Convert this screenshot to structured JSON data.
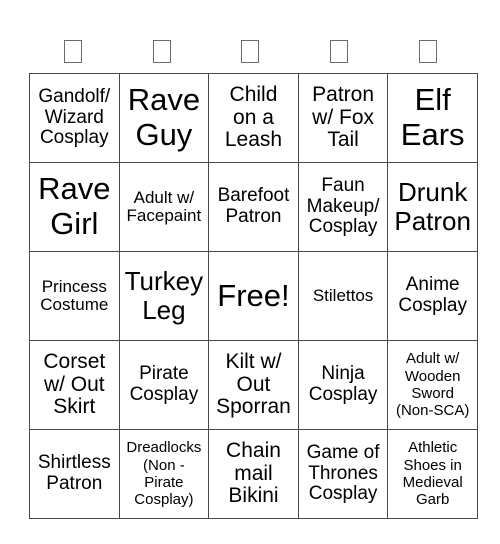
{
  "card": {
    "header": [
      "",
      "",
      "",
      "",
      ""
    ],
    "header_note": "header letters rendered as missing-glyph boxes",
    "rows": [
      [
        {
          "text": "Gandolf/\nWizard\nCosplay",
          "size": "s-ms"
        },
        {
          "text": "Rave\nGuy",
          "size": "s-xl"
        },
        {
          "text": "Child\non a\nLeash",
          "size": "s-m"
        },
        {
          "text": "Patron\nw/ Fox\nTail",
          "size": "s-m"
        },
        {
          "text": "Elf\nEars",
          "size": "s-xl"
        }
      ],
      [
        {
          "text": "Rave\nGirl",
          "size": "s-xl"
        },
        {
          "text": "Adult w/\nFacepaint",
          "size": "s-s"
        },
        {
          "text": "Barefoot\nPatron",
          "size": "s-ms"
        },
        {
          "text": "Faun\nMakeup/\nCosplay",
          "size": "s-ms"
        },
        {
          "text": "Drunk\nPatron",
          "size": "s-l"
        }
      ],
      [
        {
          "text": "Princess\nCostume",
          "size": "s-s"
        },
        {
          "text": "Turkey\nLeg",
          "size": "s-l"
        },
        {
          "text": "Free!",
          "size": "s-xl"
        },
        {
          "text": "Stilettos",
          "size": "s-s"
        },
        {
          "text": "Anime\nCosplay",
          "size": "s-ms"
        }
      ],
      [
        {
          "text": "Corset\nw/ Out\nSkirt",
          "size": "s-m"
        },
        {
          "text": "Pirate\nCosplay",
          "size": "s-ms"
        },
        {
          "text": "Kilt w/\nOut\nSporran",
          "size": "s-m"
        },
        {
          "text": "Ninja\nCosplay",
          "size": "s-ms"
        },
        {
          "text": "Adult w/\nWooden\nSword\n(Non-SCA)",
          "size": "s-xs"
        }
      ],
      [
        {
          "text": "Shirtless\nPatron",
          "size": "s-ms"
        },
        {
          "text": "Dreadlocks\n(Non -\nPirate\nCosplay)",
          "size": "s-xs"
        },
        {
          "text": "Chain\nmail\nBikini",
          "size": "s-m"
        },
        {
          "text": "Game of\nThrones\nCosplay",
          "size": "s-ms"
        },
        {
          "text": "Athletic\nShoes in\nMedieval\nGarb",
          "size": "s-xs"
        }
      ]
    ]
  }
}
